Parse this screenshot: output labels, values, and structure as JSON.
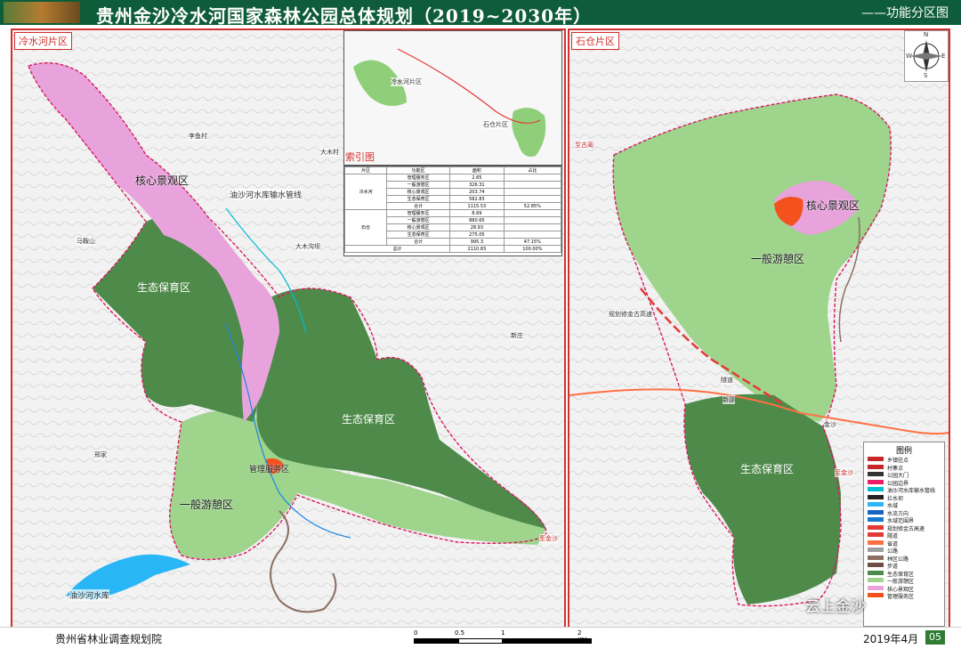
{
  "header": {
    "title": "贵州金沙冷水河国家森林公园总体规划（2019~2030年）",
    "subtitle": "——功能分区图"
  },
  "left_panel": {
    "label": "冷水河片区",
    "zones": {
      "core": "核心景观区",
      "eco1": "生态保育区",
      "eco2": "生态保育区",
      "general": "一般游憩区",
      "mgmt": "管理服务区"
    },
    "places": {
      "p1": "李鱼村",
      "p2": "大木村",
      "p3": "大木沟坝",
      "p4": "马鞍山",
      "p5": "新庄",
      "p6": "邢家",
      "pipeline": "油沙河水库输水管线",
      "reservoir": "油沙河水库",
      "exit": "至金沙"
    }
  },
  "inset": {
    "label": "索引图",
    "area1": "冷水河片区",
    "area2": "石仓片区"
  },
  "table": {
    "headers": [
      "片区",
      "功能区",
      "面积",
      "占比"
    ],
    "groups": [
      {
        "name": "冷水河",
        "rows": [
          [
            "管理服务区",
            "2.65",
            ""
          ],
          [
            "一般游憩区",
            "326.31",
            ""
          ],
          [
            "核心景观区",
            "203.74",
            ""
          ],
          [
            "生态保育区",
            "582.83",
            ""
          ],
          [
            "合计",
            "1115.53",
            "52.85%"
          ]
        ]
      },
      {
        "name": "石仓",
        "rows": [
          [
            "管理服务区",
            "8.69",
            ""
          ],
          [
            "一般游憩区",
            "880.65",
            ""
          ],
          [
            "核心景观区",
            "28.93",
            ""
          ],
          [
            "生态保育区",
            "275.05",
            ""
          ],
          [
            "合计",
            "995.3",
            "47.15%"
          ]
        ]
      }
    ],
    "total": [
      "总计",
      "2110.83",
      "100.00%"
    ]
  },
  "right_panel": {
    "label": "石仓片区",
    "zones": {
      "core": "核心景观区",
      "general": "一般游憩区",
      "eco": "生态保育区"
    },
    "places": {
      "highway": "规划修金古高速",
      "tunnel": "隧道",
      "xinshao": "新邵",
      "jinshan": "金沙",
      "exit": "至金沙",
      "gulin": "至古蔺"
    }
  },
  "compass": {
    "n": "N",
    "s": "S",
    "e": "E",
    "w": "W"
  },
  "legend": {
    "title": "图例",
    "items": [
      {
        "label": "乡镇驻点",
        "color": "#c62828"
      },
      {
        "label": "村寨点",
        "color": "#c62828"
      },
      {
        "label": "公园大门",
        "color": "#333333"
      },
      {
        "label": "公园边界",
        "color": "#e91e63"
      },
      {
        "label": "油沙河水库输水管线",
        "color": "#00bcd4"
      },
      {
        "label": "拦水坝",
        "color": "#222222"
      },
      {
        "label": "水域",
        "color": "#29b6f6"
      },
      {
        "label": "水流方向",
        "color": "#1565c0"
      },
      {
        "label": "水域范围界",
        "color": "#1976d2"
      },
      {
        "label": "规划修金古高速",
        "color": "#e53935"
      },
      {
        "label": "隧道",
        "color": "#e53935"
      },
      {
        "label": "省道",
        "color": "#ff7043"
      },
      {
        "label": "公路",
        "color": "#9e9e9e"
      },
      {
        "label": "林区公路",
        "color": "#8d6e63"
      },
      {
        "label": "步道",
        "color": "#6d4c41"
      },
      {
        "label": "生态保育区",
        "color": "#4e8a4a"
      },
      {
        "label": "一般游憩区",
        "color": "#9ed48c"
      },
      {
        "label": "核心景观区",
        "color": "#e8a3dc"
      },
      {
        "label": "管理服务区",
        "color": "#f4511e"
      }
    ]
  },
  "footer": {
    "org": "贵州省林业调查规划院",
    "date": "2019年4月",
    "page": "05",
    "scale": [
      "0",
      "0.5",
      "1",
      "2 KM"
    ]
  },
  "watermark": "云上金沙"
}
